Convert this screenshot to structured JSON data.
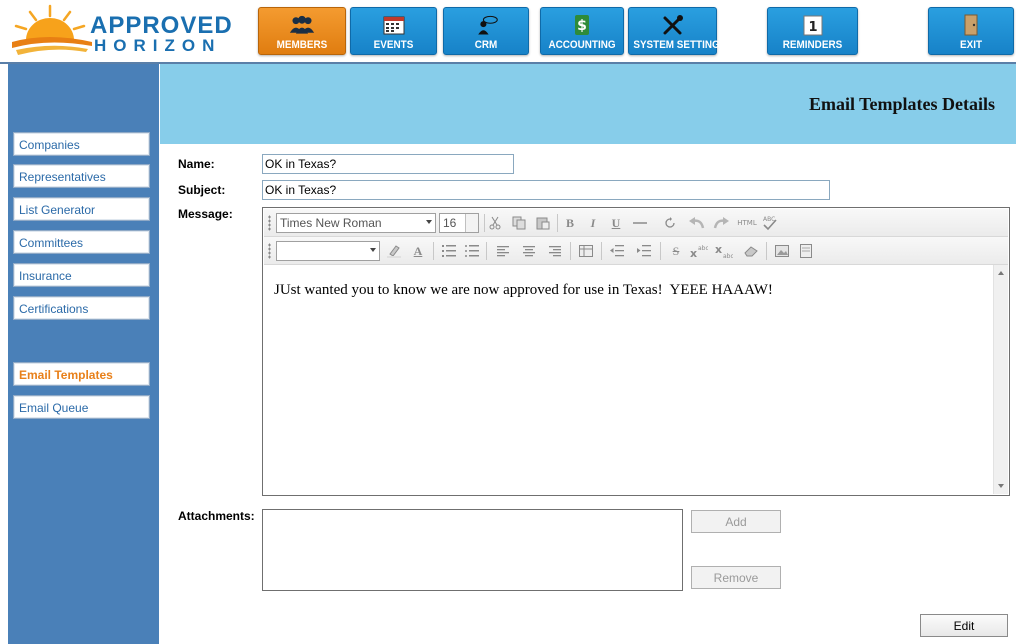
{
  "app": {
    "logo_line1": "APPROVED",
    "logo_line2": "HORIZON"
  },
  "nav": {
    "members": "MEMBERS",
    "events": "EVENTS",
    "crm": "CRM",
    "accounting": "ACCOUNTING",
    "system_settings": "SYSTEM SETTINGS",
    "reminders": "REMINDERS",
    "exit": "EXIT",
    "reminders_count": "1",
    "active": "MEMBERS"
  },
  "sidebar": {
    "items": [
      {
        "label": "Companies"
      },
      {
        "label": "Representatives"
      },
      {
        "label": "List Generator"
      },
      {
        "label": "Committees"
      },
      {
        "label": "Insurance"
      },
      {
        "label": "Certifications"
      },
      {
        "label": "Email Templates"
      },
      {
        "label": "Email Queue"
      }
    ],
    "active": "Email Templates"
  },
  "header": {
    "title": "Email Templates Details"
  },
  "form": {
    "name_label": "Name:",
    "name_value": "OK in Texas?",
    "subject_label": "Subject:",
    "subject_value": "OK in Texas?",
    "message_label": "Message:",
    "attachments_label": "Attachments:"
  },
  "editor": {
    "font_family": "Times New Roman",
    "font_size": "16",
    "body_text": "JUst wanted you to know we are now approved for use in Texas!  YEEE HAAAW!",
    "toolbar_html": "HTML",
    "toolbar_abc": "ABC",
    "bold_glyph": "B",
    "italic_glyph": "I",
    "underline_glyph": "U",
    "strike_glyph": "S",
    "color_glyph": "A"
  },
  "buttons": {
    "add": "Add",
    "remove": "Remove",
    "edit": "Edit"
  },
  "colors": {
    "nav_blue": "#1782c8",
    "nav_active_orange": "#e07d10",
    "sidebar_blue": "#4a80b8",
    "header_band": "#87cdea",
    "sidebar_active_text": "#e8801a"
  }
}
